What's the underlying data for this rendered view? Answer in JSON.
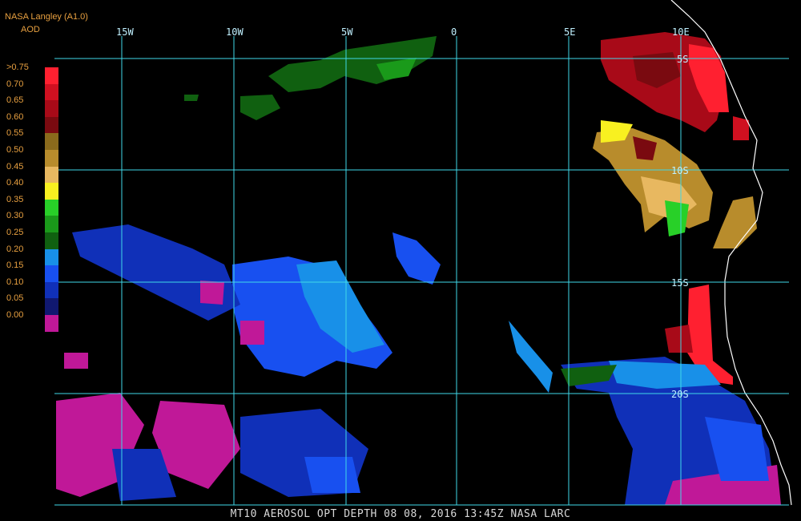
{
  "header": {
    "source": "NASA Langley (A1.0)",
    "product": "AOD"
  },
  "legend": {
    "items": [
      {
        "label": ">0.75",
        "color": "#ff2030"
      },
      {
        "label": "0.70",
        "color": "#d01020"
      },
      {
        "label": "0.65",
        "color": "#a80a18"
      },
      {
        "label": "0.60",
        "color": "#7a0a10"
      },
      {
        "label": "0.55",
        "color": "#8a6a1c"
      },
      {
        "label": "0.50",
        "color": "#b88c2c"
      },
      {
        "label": "0.45",
        "color": "#e8b860"
      },
      {
        "label": "0.40",
        "color": "#f8f020"
      },
      {
        "label": "0.35",
        "color": "#28d028"
      },
      {
        "label": "0.30",
        "color": "#1a9a1a"
      },
      {
        "label": "0.25",
        "color": "#106010"
      },
      {
        "label": "0.20",
        "color": "#1890e8"
      },
      {
        "label": "0.15",
        "color": "#1850f0"
      },
      {
        "label": "0.10",
        "color": "#1030b8"
      },
      {
        "label": "0.05",
        "color": "#101870"
      },
      {
        "label": "0.00",
        "color": "#c01898"
      }
    ]
  },
  "grid": {
    "lon_labels": [
      "15W",
      "10W",
      "5W",
      "0",
      "5E",
      "10E"
    ],
    "lat_labels": [
      "5S",
      "10S",
      "15S",
      "20S"
    ]
  },
  "footer": {
    "text": "MT10  AEROSOL OPT DEPTH   08 08, 2016 13:45Z   NASA LARC"
  }
}
